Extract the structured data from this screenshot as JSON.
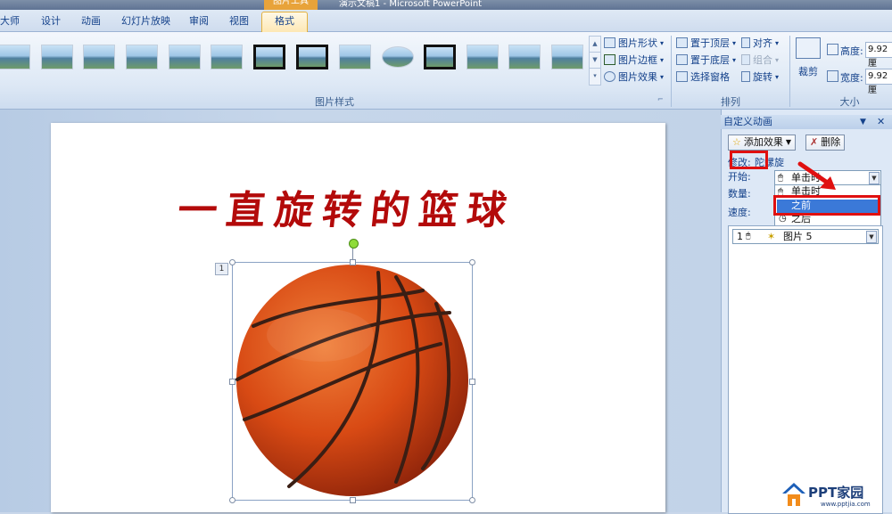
{
  "window": {
    "context_tab": "图片工具",
    "title": "演示文稿1 - Microsoft PowerPoint"
  },
  "tabs": [
    "大师",
    "设计",
    "动画",
    "幻灯片放映",
    "审阅",
    "视图",
    "格式"
  ],
  "ribbon": {
    "picture_styles": {
      "shape": "图片形状",
      "border": "图片边框",
      "effects": "图片效果",
      "group_label": "图片样式"
    },
    "arrange": {
      "bring_to_front": "置于顶层",
      "send_to_back": "置于底层",
      "selection_pane": "选择窗格",
      "align": "对齐",
      "group": "组合",
      "rotate": "旋转",
      "group_label": "排列"
    },
    "size": {
      "crop": "裁剪",
      "height_label": "高度:",
      "height_value": "9.92 厘",
      "width_label": "宽度:",
      "width_value": "9.92 厘",
      "group_label": "大小"
    }
  },
  "slide": {
    "title": "一直旋转的篮球",
    "animation_tag": "1"
  },
  "task_pane": {
    "title": "自定义动画",
    "add_effect": "添加效果",
    "remove": "删除",
    "modify_label": "修改:",
    "modify_value": "陀螺旋",
    "start_label": "开始:",
    "start_value": "单击时",
    "amount_label": "数量:",
    "speed_label": "速度:",
    "start_options": [
      "单击时",
      "之前",
      "之后"
    ],
    "list_item": {
      "index": "1",
      "name": "图片 5"
    }
  },
  "watermark": {
    "brand": "PPT家园",
    "url": "www.pptjia.com"
  },
  "colors": {
    "accent_red": "#e01010",
    "title_red": "#b30a0a",
    "ribbon_text": "#15428b",
    "selected_option_bg": "#3b79d8"
  },
  "icons": [
    "star-add-icon",
    "remove-icon",
    "mouse-click-icon",
    "clock-icon",
    "picture-effect-icon",
    "dropdown-arrow-icon"
  ]
}
